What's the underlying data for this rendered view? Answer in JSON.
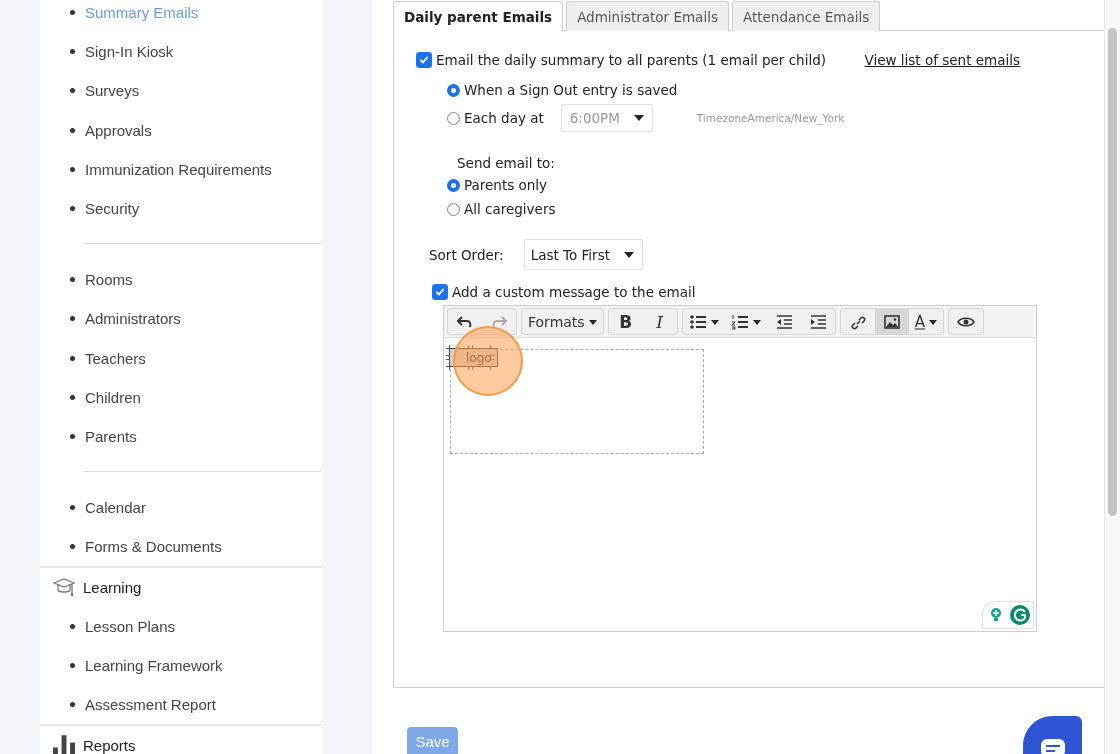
{
  "sidebar": {
    "groups": [
      {
        "items": [
          {
            "label": "Summary Emails",
            "selected": true
          },
          {
            "label": "Sign-In Kiosk",
            "selected": false
          },
          {
            "label": "Surveys",
            "selected": false
          },
          {
            "label": "Approvals",
            "selected": false
          },
          {
            "label": "Immunization Requirements",
            "selected": false
          },
          {
            "label": "Security",
            "selected": false
          }
        ]
      },
      {
        "items": [
          {
            "label": "Rooms",
            "selected": false
          },
          {
            "label": "Administrators",
            "selected": false
          },
          {
            "label": "Teachers",
            "selected": false
          },
          {
            "label": "Children",
            "selected": false
          },
          {
            "label": "Parents",
            "selected": false
          }
        ]
      },
      {
        "items": [
          {
            "label": "Calendar",
            "selected": false
          },
          {
            "label": "Forms & Documents",
            "selected": false
          }
        ]
      },
      {
        "heading": {
          "label": "Learning",
          "kind": "learning"
        },
        "items": [
          {
            "label": "Lesson Plans",
            "selected": false
          },
          {
            "label": "Learning Framework",
            "selected": false
          },
          {
            "label": "Assessment Report",
            "selected": false
          }
        ]
      },
      {
        "heading": {
          "label": "Reports",
          "kind": "reports"
        }
      }
    ]
  },
  "tabs": [
    {
      "label": "Daily parent Emails",
      "selected": true
    },
    {
      "label": "Administrator Emails",
      "selected": false
    },
    {
      "label": "Attendance Emails",
      "selected": false
    }
  ],
  "daily_summary": {
    "label": "Email the daily summary to all parents (1 email per child)",
    "checked": true,
    "link": "View list of sent emails"
  },
  "timing": [
    {
      "label": "When a Sign Out entry is saved",
      "selected": true
    },
    {
      "label": "Each day at",
      "selected": false,
      "time": {
        "value": "6:00PM",
        "disabled": true
      },
      "timezone": "TimezoneAmerica/New_York"
    }
  ],
  "send_to": {
    "label": "Send email to:",
    "options": [
      {
        "label": "Parents only",
        "selected": true
      },
      {
        "label": "All caregivers",
        "selected": false
      }
    ]
  },
  "sort_order": {
    "label": "Sort Order:",
    "value": "Last To First"
  },
  "custom_message": {
    "label": "Add a custom message to the email",
    "checked": true
  },
  "editor": {
    "toolbar": [
      [
        {
          "kind": "undo",
          "disabled": false
        },
        {
          "kind": "redo",
          "disabled": true
        }
      ],
      [
        {
          "kind": "formats",
          "label": "Formats"
        }
      ],
      [
        {
          "kind": "bold",
          "label": "B"
        },
        {
          "kind": "italic",
          "label": "I"
        }
      ],
      [
        {
          "kind": "bullets"
        },
        {
          "kind": "numbers"
        },
        {
          "kind": "outdent"
        },
        {
          "kind": "indent"
        }
      ],
      [
        {
          "kind": "link",
          "active": false
        },
        {
          "kind": "image",
          "active": true
        },
        {
          "kind": "color",
          "label": "A"
        }
      ],
      [
        {
          "kind": "preview"
        }
      ]
    ],
    "image": {
      "alt": "logo",
      "selected": true
    }
  },
  "save_button": "Save"
}
